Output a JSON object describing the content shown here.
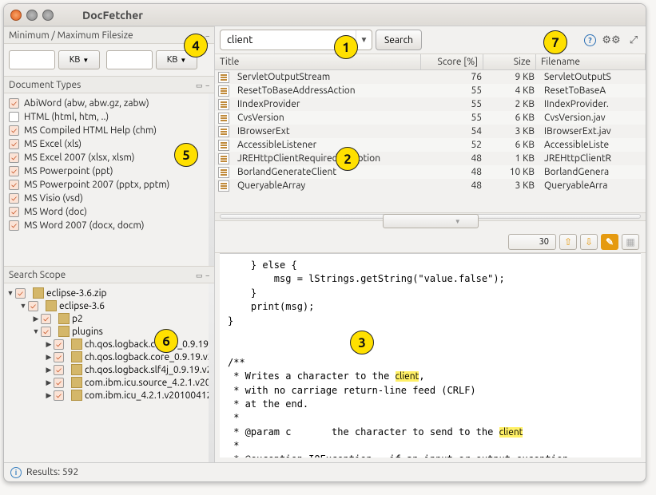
{
  "window": {
    "title": "DocFetcher"
  },
  "filesize": {
    "header": "Minimum / Maximum Filesize",
    "min_value": "",
    "min_unit": "KB",
    "max_value": "",
    "max_unit": "KB"
  },
  "doc_types": {
    "header": "Document Types",
    "items": [
      {
        "label": "AbiWord (abw, abw.gz, zabw)",
        "checked": true
      },
      {
        "label": "HTML (html, htm, ..)",
        "checked": false
      },
      {
        "label": "MS Compiled HTML Help (chm)",
        "checked": true
      },
      {
        "label": "MS Excel (xls)",
        "checked": true
      },
      {
        "label": "MS Excel 2007 (xlsx, xlsm)",
        "checked": true
      },
      {
        "label": "MS Powerpoint (ppt)",
        "checked": true
      },
      {
        "label": "MS Powerpoint 2007 (pptx, pptm)",
        "checked": true
      },
      {
        "label": "MS Visio (vsd)",
        "checked": true
      },
      {
        "label": "MS Word (doc)",
        "checked": true
      },
      {
        "label": "MS Word 2007 (docx, docm)",
        "checked": true
      }
    ]
  },
  "search_scope": {
    "header": "Search Scope",
    "tree": [
      {
        "depth": 0,
        "expand": "▼",
        "checked": true,
        "label": "eclipse-3.6.zip"
      },
      {
        "depth": 1,
        "expand": "▼",
        "checked": true,
        "label": "eclipse-3.6"
      },
      {
        "depth": 2,
        "expand": "▶",
        "checked": true,
        "label": "p2"
      },
      {
        "depth": 2,
        "expand": "▼",
        "checked": true,
        "label": "plugins"
      },
      {
        "depth": 3,
        "expand": "▶",
        "checked": true,
        "label": "ch.qos.logback.classic_0.9.19."
      },
      {
        "depth": 3,
        "expand": "▶",
        "checked": true,
        "label": "ch.qos.logback.core_0.9.19.v2"
      },
      {
        "depth": 3,
        "expand": "▶",
        "checked": true,
        "label": "ch.qos.logback.slf4j_0.9.19.v2"
      },
      {
        "depth": 3,
        "expand": "▶",
        "checked": true,
        "label": "com.ibm.icu.source_4.2.1.v20"
      },
      {
        "depth": 3,
        "expand": "▶",
        "checked": true,
        "label": "com.ibm.icu_4.2.1.v20100412"
      }
    ]
  },
  "statusbar": {
    "text": "Results: 592"
  },
  "search": {
    "value": "client",
    "button": "Search"
  },
  "results": {
    "columns": {
      "title": "Title",
      "score": "Score [%]",
      "size": "Size",
      "filename": "Filename"
    },
    "rows": [
      {
        "title": "ServletOutputStream",
        "score": "76",
        "size": "9 KB",
        "filename": "ServletOutputS"
      },
      {
        "title": "ResetToBaseAddressAction",
        "score": "55",
        "size": "4 KB",
        "filename": "ResetToBaseA"
      },
      {
        "title": "IIndexProvider",
        "score": "55",
        "size": "2 KB",
        "filename": "IIndexProvider."
      },
      {
        "title": "CvsVersion",
        "score": "55",
        "size": "6 KB",
        "filename": "CvsVersion.jav"
      },
      {
        "title": "IBrowserExt",
        "score": "54",
        "size": "3 KB",
        "filename": "IBrowserExt.jav"
      },
      {
        "title": "AccessibleListener",
        "score": "52",
        "size": "6 KB",
        "filename": "AccessibleListe"
      },
      {
        "title": "JREHttpClientRequiredException",
        "score": "48",
        "size": "1 KB",
        "filename": "JREHttpClientR"
      },
      {
        "title": "BorlandGenerateClient",
        "score": "48",
        "size": "10 KB",
        "filename": "BorlandGenera"
      },
      {
        "title": "QueryableArray",
        "score": "48",
        "size": "3 KB",
        "filename": "QueryableArra"
      }
    ]
  },
  "preview": {
    "count": "30"
  },
  "annotations": {
    "a1": "1",
    "a2": "2",
    "a3": "3",
    "a4": "4",
    "a5": "5",
    "a6": "6",
    "a7": "7"
  }
}
